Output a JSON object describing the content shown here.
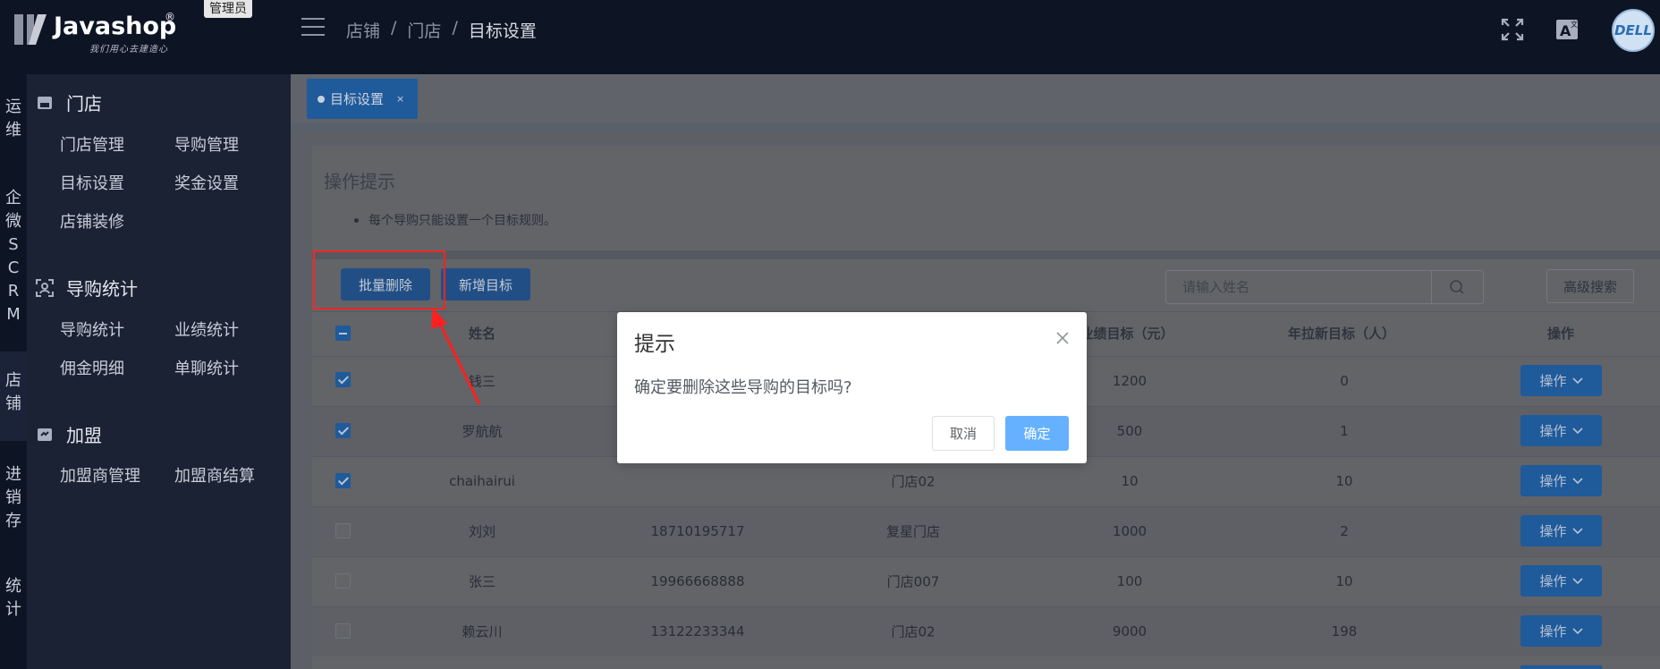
{
  "app": {
    "logo_text": "Javashop",
    "logo_registered": "®",
    "logo_slogan": "我们用心去建造心",
    "role_badge": "管理员",
    "avatar_text": "DELL"
  },
  "breadcrumb": [
    "店铺",
    "/",
    "门店",
    "/",
    "目标设置"
  ],
  "rail": [
    "运维",
    "企微SCRM",
    "店铺",
    "进销存",
    "统计"
  ],
  "sidebar": {
    "sections": [
      {
        "title": "门店",
        "icon": "store-icon",
        "items": [
          "门店管理",
          "导购管理",
          "目标设置",
          "奖金设置",
          "店铺装修"
        ]
      },
      {
        "title": "导购统计",
        "icon": "user-scan-icon",
        "items": [
          "导购统计",
          "业绩统计",
          "佣金明细",
          "单聊统计"
        ]
      },
      {
        "title": "加盟",
        "icon": "franchise-icon",
        "items": [
          "加盟商管理",
          "加盟商结算"
        ]
      }
    ]
  },
  "tab": {
    "label": "目标设置",
    "close": "×"
  },
  "tips": {
    "title": "操作提示",
    "items": [
      "每个导购只能设置一个目标规则。"
    ]
  },
  "toolbar": {
    "batch_delete": "批量删除",
    "add_target": "新增目标",
    "search_placeholder": "请输入姓名",
    "advanced_search": "高级搜索"
  },
  "table": {
    "headers": [
      "姓名",
      "业绩目标（元）",
      "年拉新目标（人）",
      "操作"
    ],
    "rows": [
      {
        "checked": true,
        "name": "钱三",
        "phone": "",
        "store": "",
        "sales_target": "1200",
        "new_target": "0"
      },
      {
        "checked": true,
        "name": "罗航航",
        "phone": "",
        "store": "",
        "sales_target": "500",
        "new_target": "1"
      },
      {
        "checked": true,
        "name": "chaihairui",
        "phone": "",
        "store": "门店02",
        "sales_target": "10",
        "new_target": "10"
      },
      {
        "checked": false,
        "name": "刘刘",
        "phone": "18710195717",
        "store": "复星门店",
        "sales_target": "1000",
        "new_target": "2"
      },
      {
        "checked": false,
        "name": "张三",
        "phone": "19966668888",
        "store": "门店007",
        "sales_target": "100",
        "new_target": "10"
      },
      {
        "checked": false,
        "name": "赖云川",
        "phone": "13122233344",
        "store": "门店02",
        "sales_target": "9000",
        "new_target": "198"
      }
    ],
    "op_label": "操作"
  },
  "dialog": {
    "title": "提示",
    "message": "确定要删除这些导购的目标吗?",
    "cancel": "取消",
    "confirm": "确定"
  }
}
